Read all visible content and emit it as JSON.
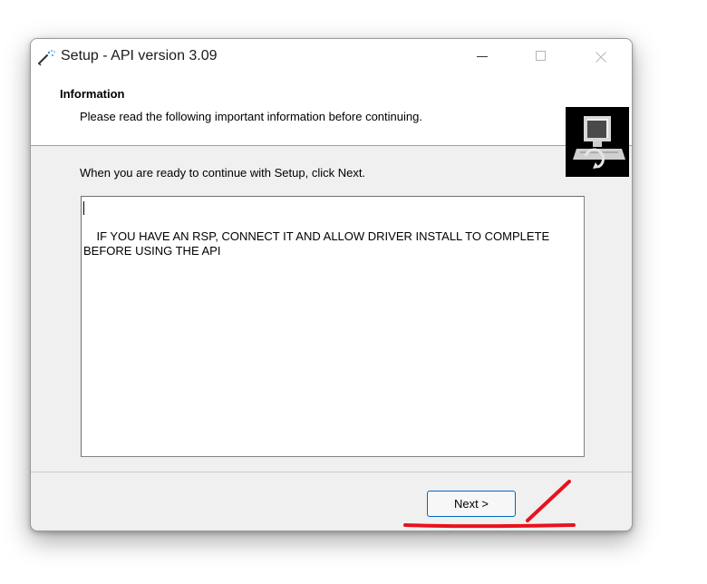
{
  "window": {
    "title": "Setup - API version 3.09",
    "icon": "setup-wand-icon",
    "controls": [
      "minimize-icon",
      "maximize-icon",
      "close-icon"
    ]
  },
  "header": {
    "title": "Information",
    "subtitle": "Please read the following important information before continuing.",
    "image": "setup-computer-icon"
  },
  "body": {
    "intro": "When you are ready to continue with Setup, click Next.",
    "info_text": "IF YOU HAVE AN RSP, CONNECT IT AND ALLOW DRIVER INSTALL TO COMPLETE\nBEFORE USING THE API"
  },
  "footer": {
    "next_label": "Next >"
  },
  "colors": {
    "accent": "#0067c0",
    "annotation": "#e8121e",
    "dialog_bg": "#f0f0f0"
  }
}
